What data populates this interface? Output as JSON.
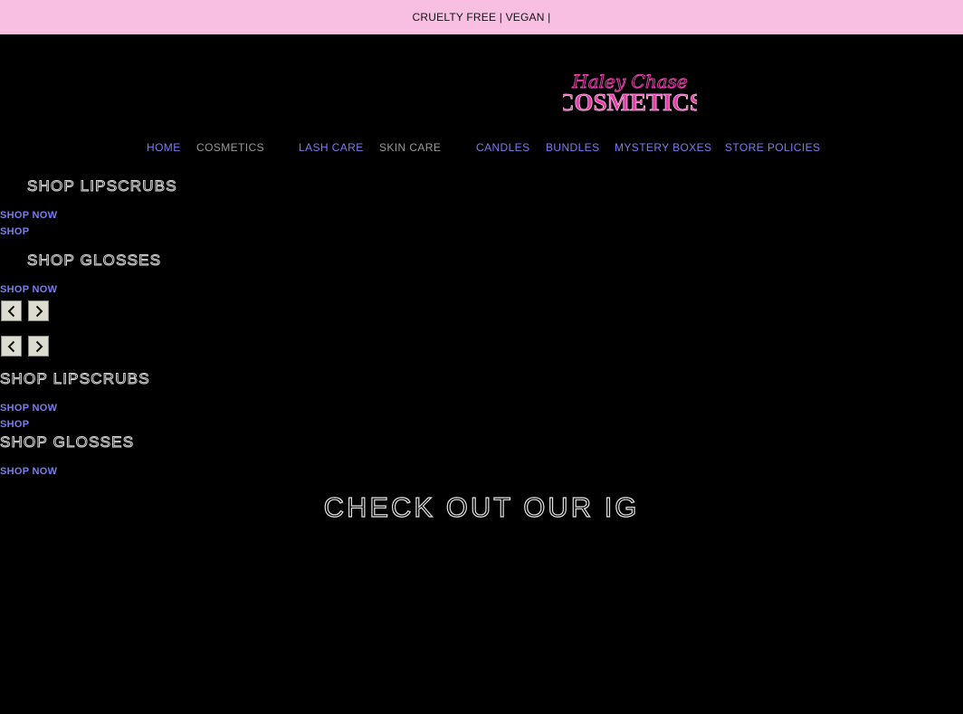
{
  "announcement": "CRUELTY FREE | VEGAN |",
  "logo": {
    "script_text": "Haley Chase",
    "main_text": "COSMETICS"
  },
  "nav": {
    "items": [
      {
        "label": "HOME"
      },
      {
        "label": "COSMETICS"
      },
      {
        "label": "LASH CARE"
      },
      {
        "label": "SKIN CARE"
      },
      {
        "label": "CANDLES"
      },
      {
        "label": "BUNDLES"
      },
      {
        "label": "MYSTERY BOXES"
      },
      {
        "label": "STORE POLICIES"
      }
    ]
  },
  "slides": {
    "first": {
      "heading_1": "SHOP LIPSCRUBS",
      "link_1": "SHOP NOW",
      "link_2": "SHOP",
      "heading_2": "SHOP GLOSSES",
      "link_3": "SHOP NOW"
    },
    "second": {
      "heading_1": "SHOP LIPSCRUBS",
      "link_1": "SHOP NOW",
      "link_2": "SHOP",
      "heading_2": "SHOP GLOSSES",
      "link_3": "SHOP NOW"
    }
  },
  "icons": {
    "prev": "chevron-left-icon",
    "next": "chevron-right-icon"
  },
  "section_heading": "CHECK OUT OUR IG",
  "colors": {
    "announcement_bg": "#f9bfe3",
    "link": "#7b7bf0",
    "background": "#000000",
    "logo_pink": "#e23fa8"
  }
}
